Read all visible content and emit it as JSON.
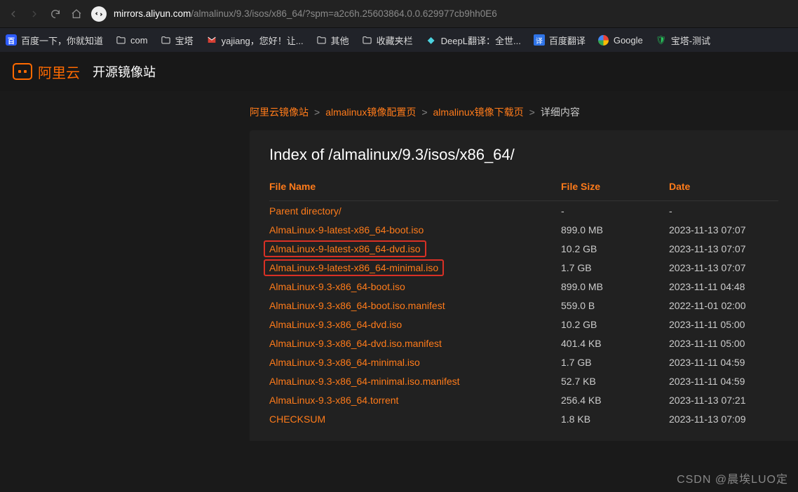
{
  "browser": {
    "url_domain": "mirrors.aliyun.com",
    "url_path": "/almalinux/9.3/isos/x86_64/?spm=a2c6h.25603864.0.0.629977cb9hh0E6"
  },
  "bookmarks": [
    {
      "label": "百度一下，你就知道",
      "icon": "baidu"
    },
    {
      "label": "com",
      "icon": "folder"
    },
    {
      "label": "宝塔",
      "icon": "folder"
    },
    {
      "label": "yajiang，您好！让...",
      "icon": "gmail"
    },
    {
      "label": "其他",
      "icon": "folder"
    },
    {
      "label": "收藏夹栏",
      "icon": "folder"
    },
    {
      "label": "DeepL翻译：全世...",
      "icon": "deepl"
    },
    {
      "label": "百度翻译",
      "icon": "trans"
    },
    {
      "label": "Google",
      "icon": "google"
    },
    {
      "label": "宝塔-测试",
      "icon": "shield"
    }
  ],
  "header": {
    "logo_text": "阿里云",
    "title": "开源镜像站"
  },
  "breadcrumb": {
    "items": [
      {
        "label": "阿里云镜像站",
        "link": true
      },
      {
        "label": "almalinux镜像配置页",
        "link": true
      },
      {
        "label": "almalinux镜像下载页",
        "link": true
      },
      {
        "label": "详细内容",
        "link": false
      }
    ],
    "sep": ">"
  },
  "panel": {
    "heading": "Index of /almalinux/9.3/isos/x86_64/",
    "columns": {
      "name": "File Name",
      "size": "File Size",
      "date": "Date"
    },
    "rows": [
      {
        "name": "Parent directory/",
        "size": "-",
        "date": "-",
        "highlight": false
      },
      {
        "name": "AlmaLinux-9-latest-x86_64-boot.iso",
        "size": "899.0 MB",
        "date": "2023-11-13 07:07",
        "highlight": false
      },
      {
        "name": "AlmaLinux-9-latest-x86_64-dvd.iso",
        "size": "10.2 GB",
        "date": "2023-11-13 07:07",
        "highlight": true
      },
      {
        "name": "AlmaLinux-9-latest-x86_64-minimal.iso",
        "size": "1.7 GB",
        "date": "2023-11-13 07:07",
        "highlight": true
      },
      {
        "name": "AlmaLinux-9.3-x86_64-boot.iso",
        "size": "899.0 MB",
        "date": "2023-11-11 04:48",
        "highlight": false
      },
      {
        "name": "AlmaLinux-9.3-x86_64-boot.iso.manifest",
        "size": "559.0 B",
        "date": "2022-11-01 02:00",
        "highlight": false
      },
      {
        "name": "AlmaLinux-9.3-x86_64-dvd.iso",
        "size": "10.2 GB",
        "date": "2023-11-11 05:00",
        "highlight": false
      },
      {
        "name": "AlmaLinux-9.3-x86_64-dvd.iso.manifest",
        "size": "401.4 KB",
        "date": "2023-11-11 05:00",
        "highlight": false
      },
      {
        "name": "AlmaLinux-9.3-x86_64-minimal.iso",
        "size": "1.7 GB",
        "date": "2023-11-11 04:59",
        "highlight": false
      },
      {
        "name": "AlmaLinux-9.3-x86_64-minimal.iso.manifest",
        "size": "52.7 KB",
        "date": "2023-11-11 04:59",
        "highlight": false
      },
      {
        "name": "AlmaLinux-9.3-x86_64.torrent",
        "size": "256.4 KB",
        "date": "2023-11-13 07:21",
        "highlight": false
      },
      {
        "name": "CHECKSUM",
        "size": "1.8 KB",
        "date": "2023-11-13 07:09",
        "highlight": false
      }
    ]
  },
  "watermark": "CSDN @晨埃LUO定"
}
